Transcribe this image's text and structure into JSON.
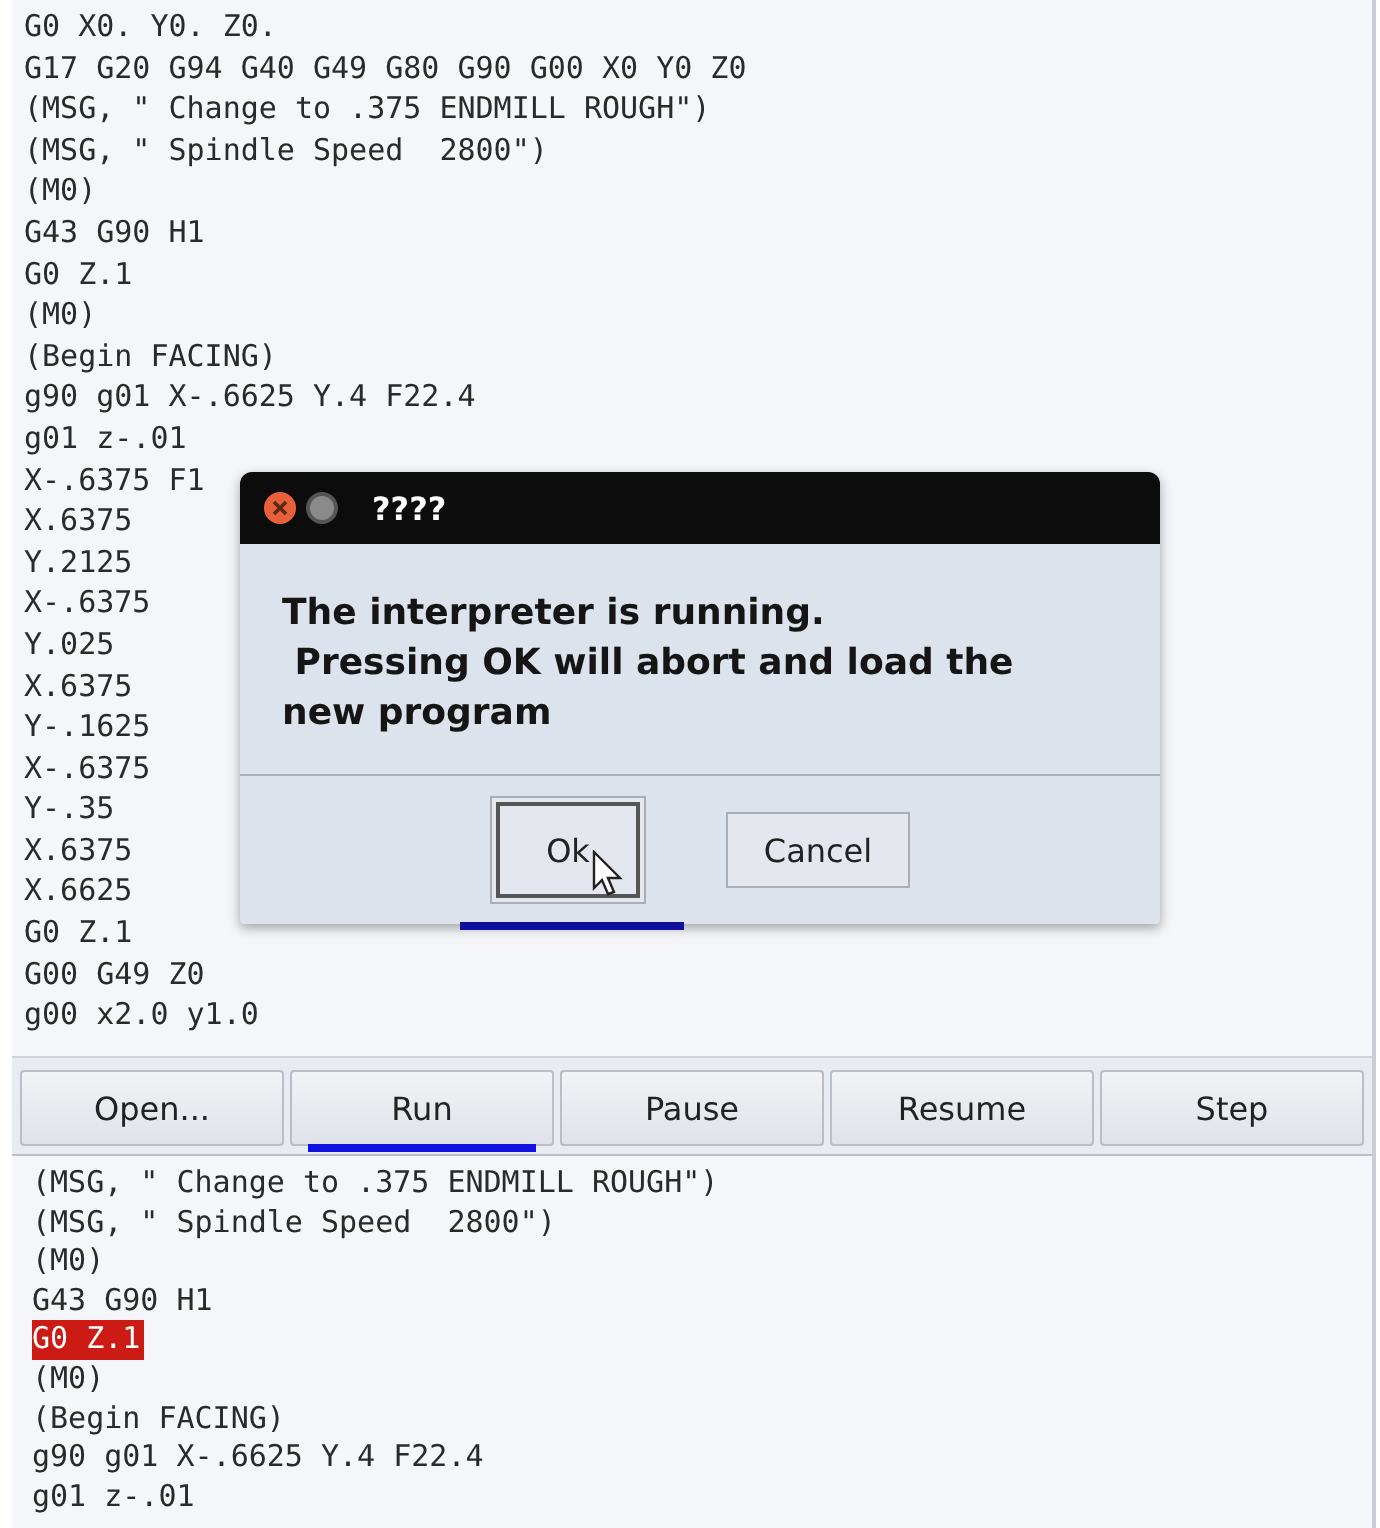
{
  "editor": {
    "lines": [
      "G0 X0. Y0. Z0.",
      "G17 G20 G94 G40 G49 G80 G90 G00 X0 Y0 Z0",
      "(MSG, \" Change to .375 ENDMILL ROUGH\")",
      "(MSG, \" Spindle Speed  2800\")",
      "(M0)",
      "G43 G90 H1",
      "G0 Z.1",
      "(M0)",
      "(Begin FACING)",
      "g90 g01 X-.6625 Y.4 F22.4",
      "g01 z-.01",
      "X-.6375 F1",
      "X.6375",
      "Y.2125",
      "X-.6375",
      "Y.025",
      "X.6375",
      "Y-.1625",
      "X-.6375",
      "Y-.35",
      "X.6375",
      "X.6625",
      "G0 Z.1",
      "G00 G49 Z0",
      "g00 x2.0 y1.0"
    ]
  },
  "dialog": {
    "title": "????",
    "message": "The interpreter is running.\n Pressing OK will abort and load the\nnew program",
    "buttons": [
      {
        "label": "Ok",
        "focused": true
      },
      {
        "label": "Cancel",
        "focused": false
      }
    ]
  },
  "toolbar": {
    "buttons": [
      {
        "label": "Open...",
        "marked": false
      },
      {
        "label": "Run",
        "marked": true
      },
      {
        "label": "Pause",
        "marked": false
      },
      {
        "label": "Resume",
        "marked": false
      },
      {
        "label": "Step",
        "marked": false
      }
    ]
  },
  "output": {
    "lines": [
      {
        "text": "(MSG, \" Change to .375 ENDMILL ROUGH\")",
        "current": false
      },
      {
        "text": "(MSG, \" Spindle Speed  2800\")",
        "current": false
      },
      {
        "text": "(M0)",
        "current": false
      },
      {
        "text": "G43 G90 H1",
        "current": false
      },
      {
        "text": "G0 Z.1",
        "current": true
      },
      {
        "text": "(M0)",
        "current": false
      },
      {
        "text": "(Begin FACING)",
        "current": false
      },
      {
        "text": "g90 g01 X-.6625 Y.4 F22.4",
        "current": false
      },
      {
        "text": "g01 z-.01",
        "current": false
      }
    ]
  }
}
